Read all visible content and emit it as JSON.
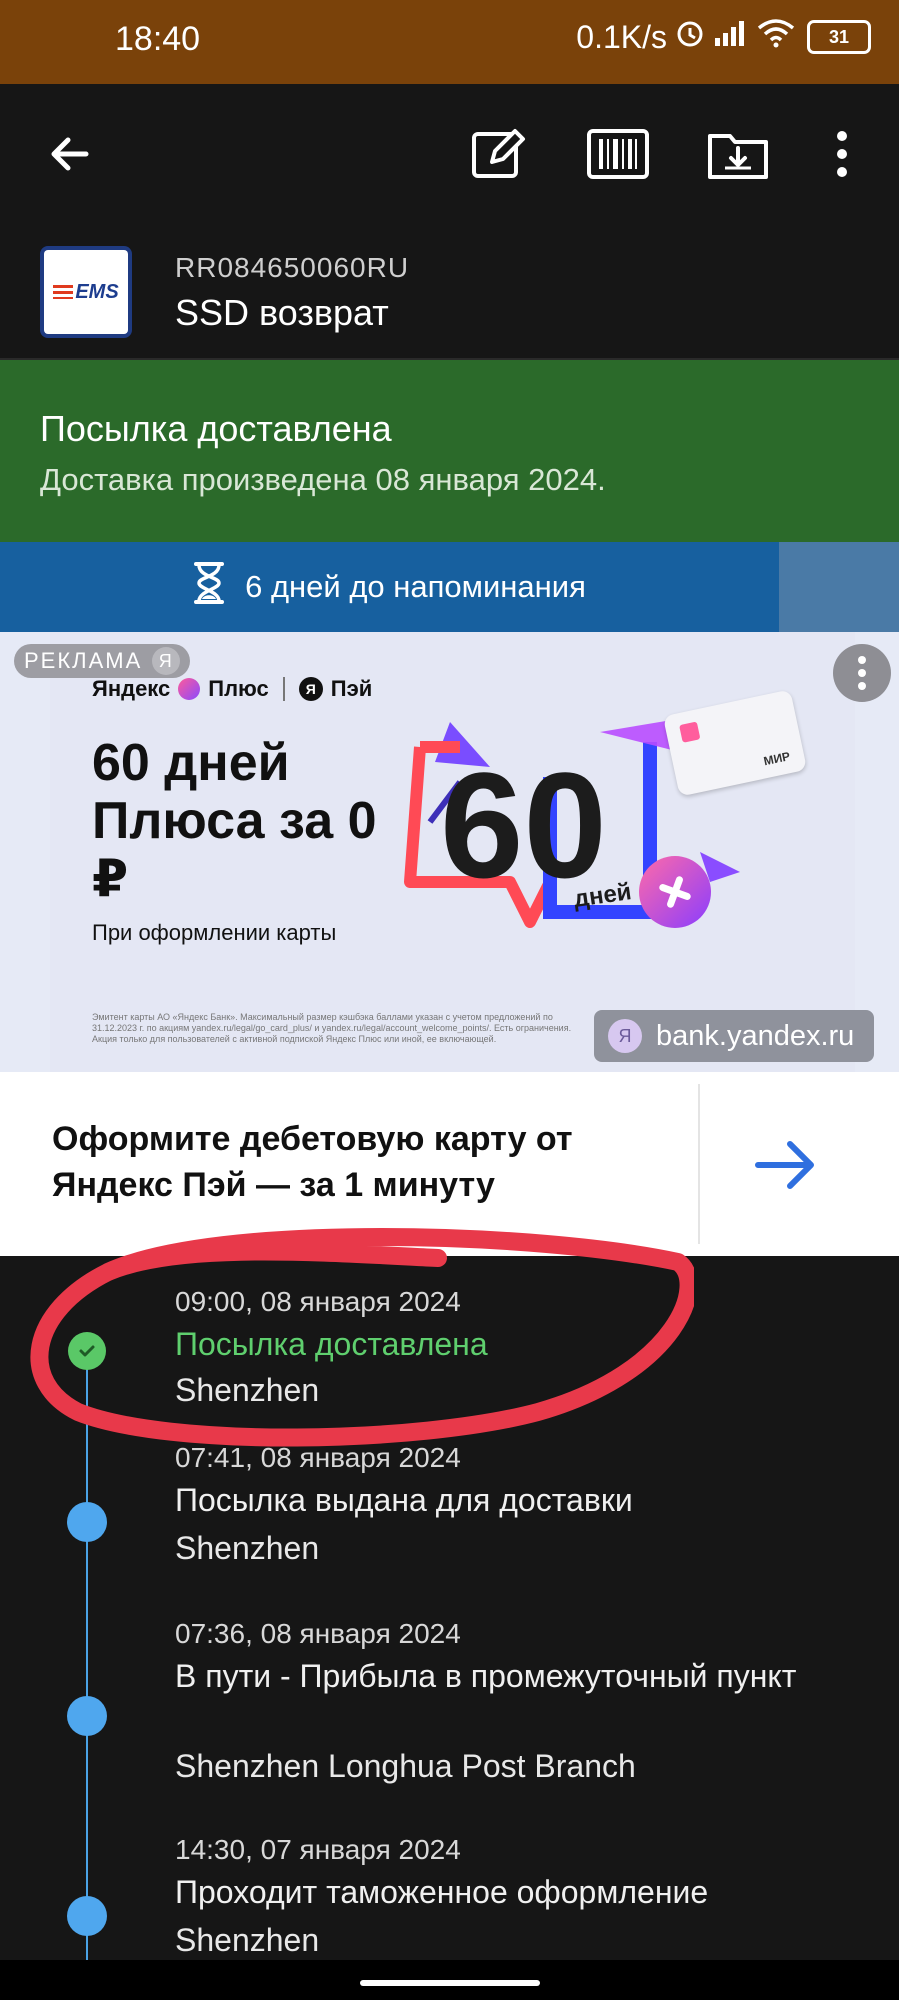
{
  "status_bar": {
    "time": "18:40",
    "net_speed": "0.1K/s",
    "battery": "31",
    "icons": [
      "alarm-icon",
      "signal-icon",
      "wifi-icon",
      "battery-icon"
    ]
  },
  "app_bar": {
    "icons": [
      "back-arrow-icon",
      "edit-icon",
      "barcode-icon",
      "archive-icon",
      "more-vert-icon"
    ]
  },
  "parcel": {
    "carrier_logo": "EMS",
    "tracking_number": "RR084650060RU",
    "name": "SSD возврат"
  },
  "delivered_banner": {
    "title": "Посылка доставлена",
    "subtitle": "Доставка произведена 08 января 2024.",
    "color": "#2b6a2a"
  },
  "reminder": {
    "icon": "hourglass-icon",
    "text": "6 дней до напоминания",
    "color": "#17609f"
  },
  "ad": {
    "label": "РЕКЛАМА",
    "badge": "Я",
    "brand_left": "Яндекс",
    "brand_plus": "Плюс",
    "brand_right": "Пэй",
    "headline": "60 дней Плюса за 0 ₽",
    "subline": "При оформлении карты",
    "big_number": "60",
    "big_number_unit": "дней",
    "card_brand": "МИР",
    "fine_print": "Эмитент карты АО «Яндекс Банк». Максимальный размер кэшбэка баллами указан с учетом предложений по 31.12.2023 г. по акциям yandex.ru/legal/go_card_plus/ и yandex.ru/legal/account_welcome_points/. Есть ограничения. Акция только для пользователей с активной подпиской Яндекс Плюс или иной, ее включающей.",
    "link": "bank.yandex.ru",
    "cta_text": "Оформите дебетовую карту от Яндекс Пэй — за 1 минуту"
  },
  "timeline": [
    {
      "time": "09:00, 08 января 2024",
      "status": "Посылка доставлена",
      "place": "Shenzhen",
      "state": "delivered"
    },
    {
      "time": "07:41, 08 января 2024",
      "status": "Посылка выдана для доставки",
      "place": "Shenzhen",
      "state": "normal"
    },
    {
      "time": "07:36, 08 января 2024",
      "status": "В пути - Прибыла в промежуточный пункт",
      "place": "Shenzhen Longhua Post Branch",
      "state": "normal"
    },
    {
      "time": "14:30, 07 января 2024",
      "status": "Проходит таможенное оформление",
      "place": "Shenzhen",
      "state": "normal"
    }
  ],
  "colors": {
    "status_bar": "#7a420a",
    "background": "#161616",
    "accent_blue": "#4fa7ee",
    "accent_green": "#5ac867",
    "annotation_red": "#e8394a"
  }
}
